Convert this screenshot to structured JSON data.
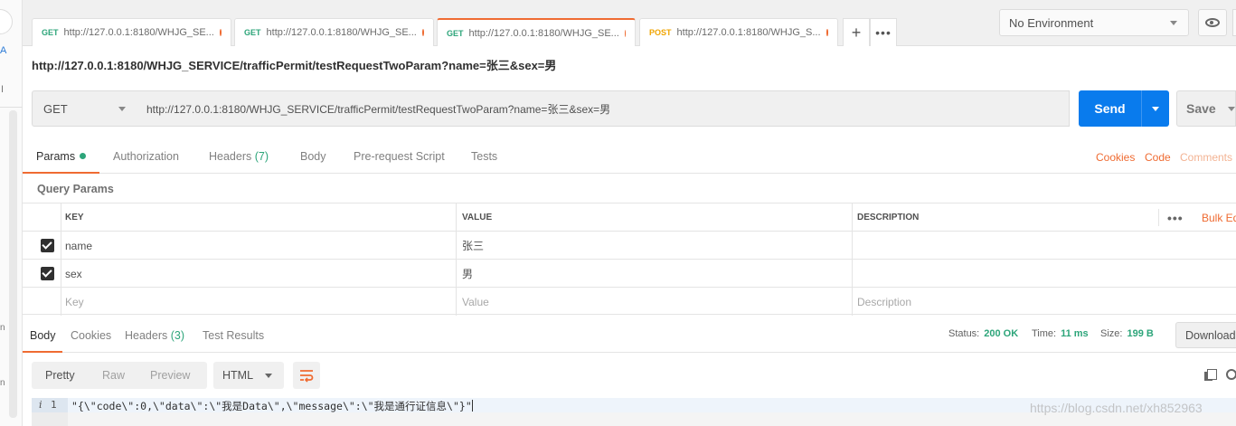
{
  "left_strip": {
    "label_a": "A",
    "label_i": "I",
    "label_n1": "n",
    "label_n2": "n"
  },
  "tabs": [
    {
      "method": "GET",
      "title": "http://127.0.0.1:8180/WHJG_SE..."
    },
    {
      "method": "GET",
      "title": "http://127.0.0.1:8180/WHJG_SE..."
    },
    {
      "method": "GET",
      "title": "http://127.0.0.1:8180/WHJG_SE..."
    },
    {
      "method": "POST",
      "title": "http://127.0.0.1:8180/WHJG_S..."
    }
  ],
  "tab_actions": {
    "add_icon": "plus-icon",
    "more_icon": "more-icon"
  },
  "environment": {
    "selected": "No Environment",
    "eye_icon": "eye-icon"
  },
  "request": {
    "title": "http://127.0.0.1:8180/WHJG_SERVICE/trafficPermit/testRequestTwoParam?name=张三&sex=男",
    "method": "GET",
    "url": "http://127.0.0.1:8180/WHJG_SERVICE/trafficPermit/testRequestTwoParam?name=张三&sex=男",
    "send_label": "Send",
    "save_label": "Save"
  },
  "request_tabs": {
    "params": "Params",
    "authorization": "Authorization",
    "headers": "Headers",
    "headers_count": "(7)",
    "body": "Body",
    "pre_request": "Pre-request Script",
    "tests": "Tests",
    "cookies": "Cookies",
    "code": "Code",
    "comments": "Comments"
  },
  "query_params": {
    "label": "Query Params",
    "col_key": "KEY",
    "col_value": "VALUE",
    "col_description": "DESCRIPTION",
    "bulk_edit": "Bulk Ed",
    "more": "•••",
    "rows": [
      {
        "key": "name",
        "value": "张三",
        "description": ""
      },
      {
        "key": "sex",
        "value": "男",
        "description": ""
      }
    ],
    "placeholder": {
      "key": "Key",
      "value": "Value",
      "description": "Description"
    }
  },
  "response_tabs": {
    "body": "Body",
    "cookies": "Cookies",
    "headers": "Headers",
    "headers_count": "(3)",
    "test_results": "Test Results",
    "status_label": "Status:",
    "status_value": "200 OK",
    "time_label": "Time:",
    "time_value": "11 ms",
    "size_label": "Size:",
    "size_value": "199 B",
    "download": "Download"
  },
  "response_toolbar": {
    "pretty": "Pretty",
    "raw": "Raw",
    "preview": "Preview",
    "language": "HTML"
  },
  "response_body": {
    "info_mark": "i",
    "line_number": "1",
    "line_text": "\"{\\\"code\\\":0,\\\"data\\\":\\\"我是Data\\\",\\\"message\\\":\\\"我是通行证信息\\\"}\""
  },
  "watermark": "https://blog.csdn.net/xh852963",
  "colors": {
    "accent": "#ef6b32",
    "send": "#097bed",
    "get": "#2da57a",
    "post": "#f0a400"
  }
}
